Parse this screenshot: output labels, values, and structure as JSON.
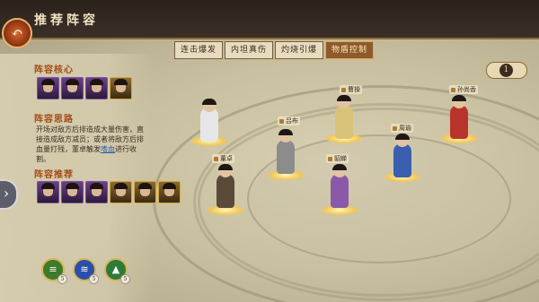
{
  "header": {
    "title": "推荐阵容",
    "back_icon": "back-arrow-icon"
  },
  "tabs": [
    {
      "label": "连击爆发",
      "active": false
    },
    {
      "label": "内坦真伤",
      "active": false
    },
    {
      "label": "灼烧引爆",
      "active": false
    },
    {
      "label": "物盾控制",
      "active": true
    }
  ],
  "left_panel": {
    "core_title": "阵容核心",
    "core_portraits": 4,
    "idea_title": "阵容思路",
    "idea_text_before": "开场对敌方后排造成大量伤害，直接造成敌方减员；或者将敌方后排血量打残，董卓触发",
    "idea_highlight": "嗜血",
    "idea_text_after": "进行收割。",
    "recommend_title": "阵容推荐",
    "recommend_portraits": 6
  },
  "counter": {
    "value": "1"
  },
  "skills": [
    {
      "icon": "scroll-icon",
      "glyph": "≡",
      "color": "#3d7a2a",
      "count": "5"
    },
    {
      "icon": "blue-skill-icon",
      "glyph": "≋",
      "color": "#2a4fa8",
      "count": "5"
    },
    {
      "icon": "green-skill-icon",
      "glyph": "▲",
      "color": "#2e7a3a",
      "count": "5"
    }
  ],
  "units": [
    {
      "name": "",
      "body_color": "#e6e6e6"
    },
    {
      "name": "曹操",
      "body_color": "#d9c27a"
    },
    {
      "name": "孙尚香",
      "body_color": "#b8342a"
    },
    {
      "name": "吕布",
      "body_color": "#8c8c8c"
    },
    {
      "name": "董卓",
      "body_color": "#5a4a3a"
    },
    {
      "name": "貂蝉",
      "body_color": "#8a5aa8"
    },
    {
      "name": "周瑜",
      "body_color": "#3a5fb0"
    }
  ]
}
